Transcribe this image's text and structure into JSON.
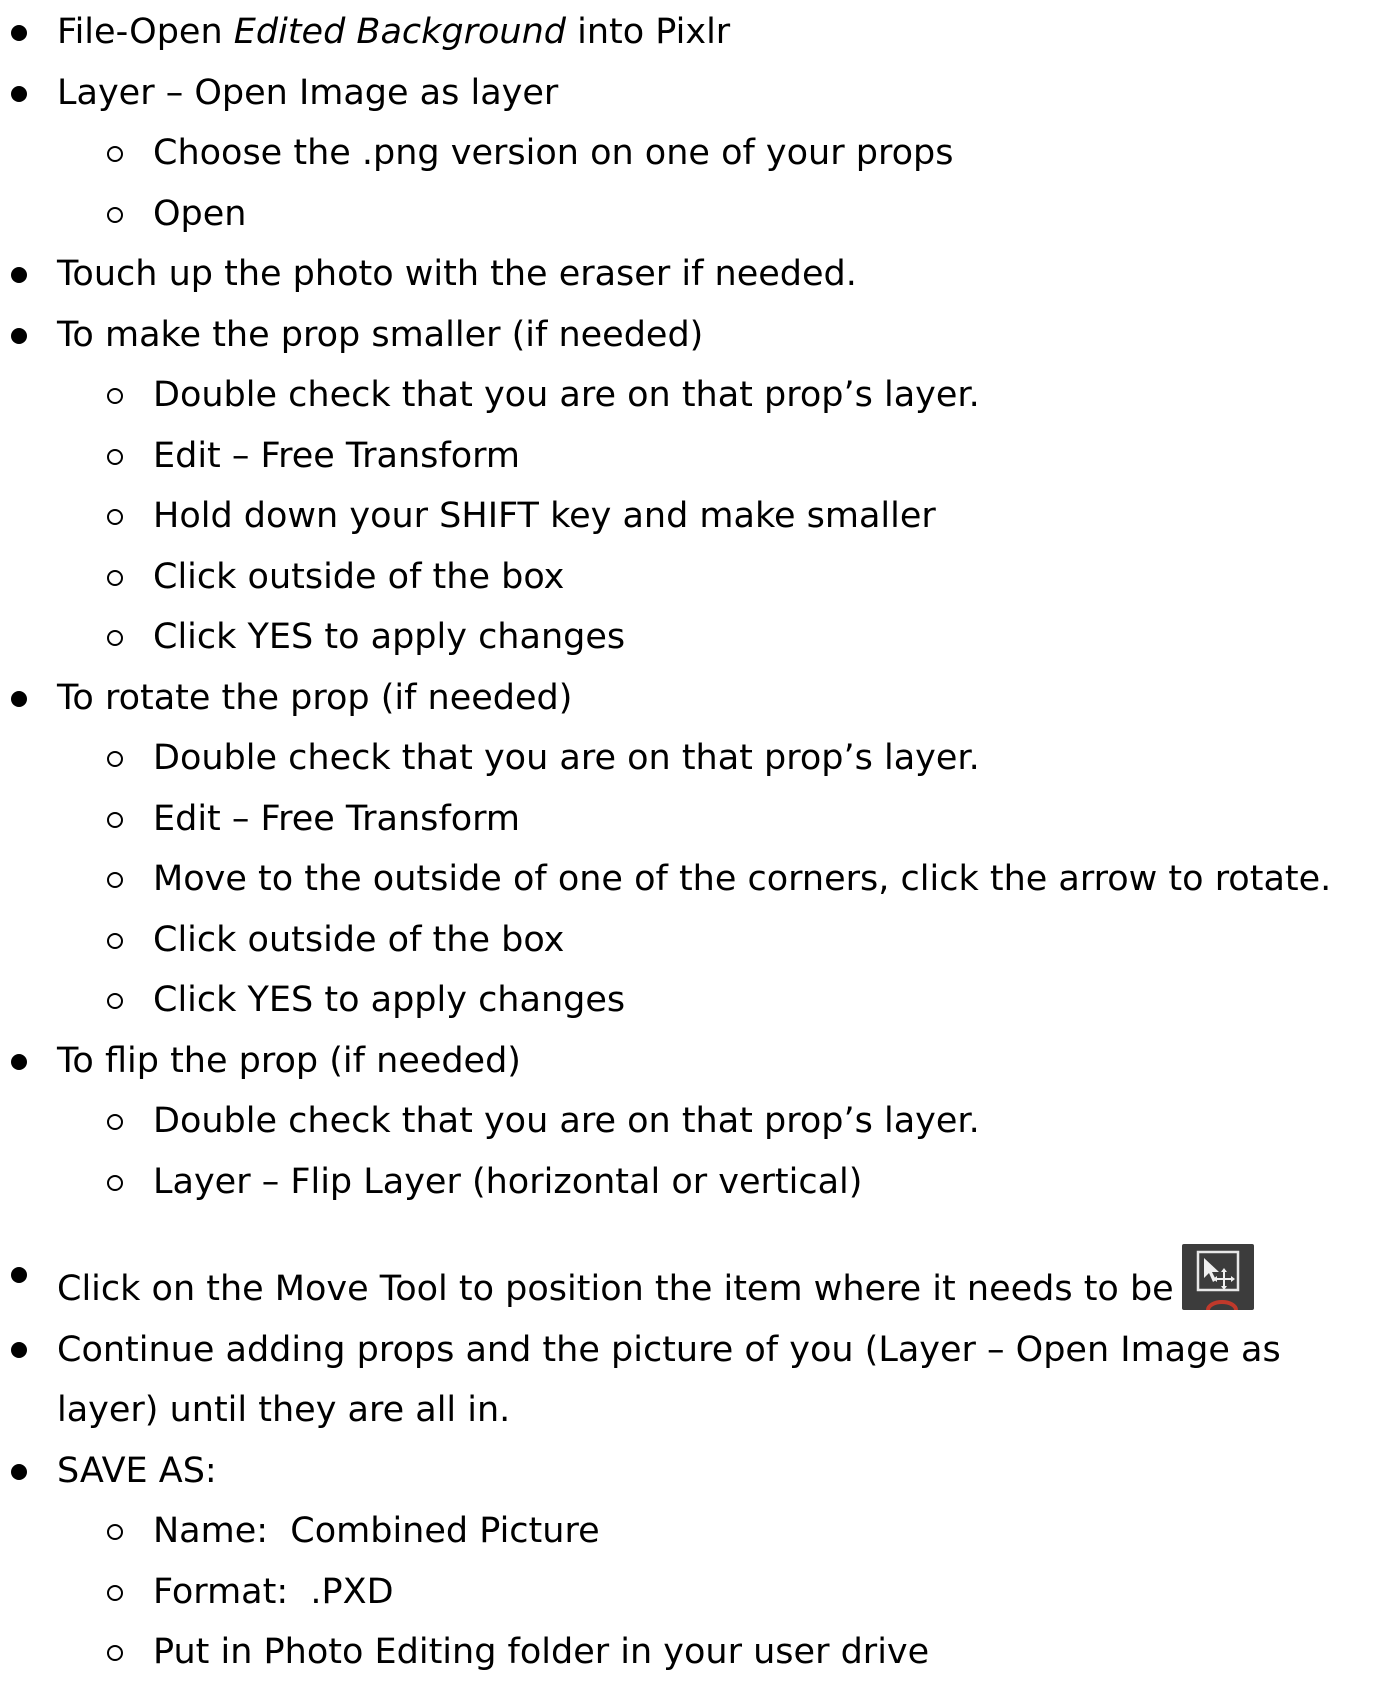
{
  "steps": [
    {
      "text_before": "File-Open ",
      "text_italic": "Edited Background",
      "text_after": " into Pixlr"
    },
    {
      "text": "Layer – Open Image as layer",
      "substeps": [
        "Choose the .png version on one of your props",
        "Open"
      ]
    },
    {
      "text": "Touch up the photo with the eraser if needed."
    },
    {
      "text": "To make the prop smaller (if needed)",
      "substeps": [
        "Double check that you are on that prop’s layer.",
        "Edit – Free Transform",
        "Hold down your SHIFT key and make smaller",
        "Click outside of the box",
        "Click YES to apply changes"
      ]
    },
    {
      "text": "To rotate the prop (if needed)",
      "substeps": [
        "Double check that you are on that prop’s layer.",
        "Edit – Free Transform",
        "Move to the outside of one of the corners, click the arrow to rotate.",
        "Click outside of the box",
        "Click YES to apply changes"
      ]
    },
    {
      "text": "To flip the prop (if needed)",
      "substeps": [
        "Double check that you are on that prop’s layer.",
        "Layer – Flip Layer (horizontal or vertical)"
      ]
    },
    {
      "text": "Click on the Move Tool to position the item where it needs to be",
      "icon": "move-tool-icon"
    },
    {
      "text": "Continue adding props and the picture of you (Layer – Open Image as layer) until they are all in."
    },
    {
      "text": "SAVE AS:",
      "substeps": [
        "Name:  Combined Picture",
        "Format:  .PXD",
        "Put in Photo Editing folder in your user drive"
      ]
    }
  ],
  "colors": {
    "text": "#000000",
    "background": "#ffffff",
    "icon_background": "#3c3c3c",
    "icon_accent": "#c0392b"
  }
}
